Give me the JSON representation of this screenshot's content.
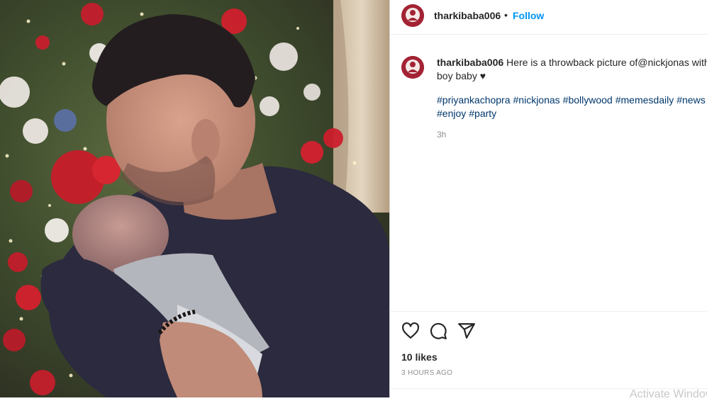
{
  "post": {
    "image_alt": "Man kissing a baby's forehead in front of a decorated Christmas tree",
    "username": "tharkibaba006",
    "separator": "•",
    "follow_label": "Follow",
    "caption": {
      "username": "tharkibaba006",
      "text_line1": " Here is a throwback picture of@nickjonas with",
      "text_line2": "boy baby ♥",
      "hashtags": [
        "#priyankachopra",
        "#nickjonas",
        "#bollywood",
        "#memesdaily",
        "#news",
        "#enjoy",
        "#party"
      ],
      "time": "3h"
    },
    "actions": {
      "like_icon": "heart-icon",
      "comment_icon": "comment-icon",
      "share_icon": "paper-plane-icon"
    },
    "likes": "10 likes",
    "posted": "3 HOURS AGO"
  },
  "overlay": {
    "watermark": "Activate Windows"
  },
  "colors": {
    "link_blue": "#0095f6",
    "hashtag": "#00376b",
    "avatar_red": "#a32334"
  }
}
